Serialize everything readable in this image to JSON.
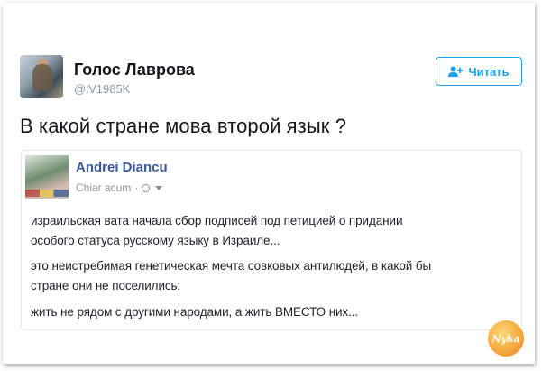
{
  "author": {
    "name": "Голос Лаврова",
    "handle": "@lV1985K"
  },
  "follow_button": {
    "label": "Читать",
    "icon": "add-user-icon",
    "color": "#1da1f2"
  },
  "tweet": {
    "text": "В какой стране мова второй язык ?"
  },
  "quoted_post": {
    "author": "Andrei Diancu",
    "time": "Chiar acum",
    "privacy_icon": "globe-icon",
    "lines": [
      "израильская вата начала сбор подписей под петицией о придании",
      "особого статуса русскому языку в Израиле...",
      "это неистребимая генетическая мечта совковых антилюдей, в какой бы",
      "стране они не поселились:",
      "жить не рядом с другими народами, а жить ВМЕСТО них..."
    ]
  },
  "watermark": {
    "text": "Nyka"
  }
}
